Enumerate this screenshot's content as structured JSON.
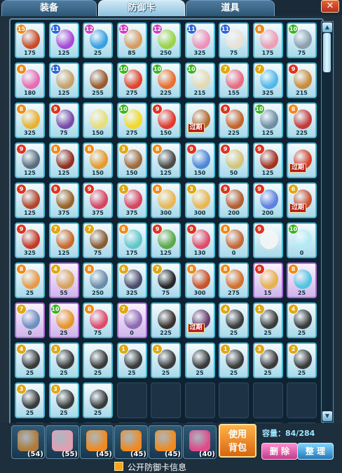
{
  "tabs": [
    {
      "label": "装备"
    },
    {
      "label": "防御卡"
    },
    {
      "label": "道具"
    }
  ],
  "close_label": "✕",
  "colors": {
    "blue_card": "#43b8d4",
    "purple_card": "#a76ad6",
    "expired": "#b31a10",
    "use_button": "#d8650d"
  },
  "cards": [
    {
      "level": "15",
      "lvl_color": "o",
      "cost": "175",
      "plant": "#c94b2a",
      "frame": "blue"
    },
    {
      "level": "11",
      "lvl_color": "b",
      "cost": "125",
      "plant": "#a94ad6",
      "frame": "blue"
    },
    {
      "level": "12",
      "lvl_color": "p",
      "cost": "25",
      "plant": "#3a9fe0",
      "frame": "blue"
    },
    {
      "level": "12",
      "lvl_color": "p",
      "cost": "85",
      "plant": "#d59b63",
      "frame": "blue"
    },
    {
      "level": "12",
      "lvl_color": "p",
      "cost": "250",
      "plant": "#9bd24a",
      "frame": "blue"
    },
    {
      "level": "11",
      "lvl_color": "b",
      "cost": "325",
      "plant": "#f08fb8",
      "frame": "blue"
    },
    {
      "level": "11",
      "lvl_color": "b",
      "cost": "75",
      "plant": "#e9e1d4",
      "frame": "blue"
    },
    {
      "level": "8",
      "lvl_color": "o",
      "cost": "175",
      "plant": "#ee9db4",
      "frame": "blue"
    },
    {
      "level": "10",
      "lvl_color": "g",
      "cost": "75",
      "plant": "#8aa0b0",
      "frame": "blue"
    },
    {
      "level": "8",
      "lvl_color": "o",
      "cost": "180",
      "plant": "#e86ab3",
      "frame": "blue"
    },
    {
      "level": "11",
      "lvl_color": "b",
      "cost": "125",
      "plant": "#c7a06b",
      "frame": "blue"
    },
    {
      "level": "",
      "lvl_color": "o",
      "cost": "255",
      "plant": "#9a5a2c",
      "frame": "blue"
    },
    {
      "level": "10",
      "lvl_color": "g",
      "cost": "275",
      "plant": "#e0452b",
      "frame": "blue"
    },
    {
      "level": "10",
      "lvl_color": "g",
      "cost": "225",
      "plant": "#e96e2e",
      "frame": "blue"
    },
    {
      "level": "10",
      "lvl_color": "g",
      "cost": "215",
      "plant": "#e4d9b2",
      "frame": "blue"
    },
    {
      "level": "7",
      "lvl_color": "y",
      "cost": "155",
      "plant": "#ea6a80",
      "frame": "blue"
    },
    {
      "level": "7",
      "lvl_color": "y",
      "cost": "325",
      "plant": "#51b6ea",
      "frame": "blue"
    },
    {
      "level": "9",
      "lvl_color": "r",
      "cost": "215",
      "plant": "#c98a3a",
      "frame": "blue"
    },
    {
      "level": "8",
      "lvl_color": "o",
      "cost": "325",
      "plant": "#e8b12f",
      "frame": "blue"
    },
    {
      "level": "9",
      "lvl_color": "r",
      "cost": "75",
      "plant": "#7a4aa8",
      "frame": "blue"
    },
    {
      "level": "",
      "lvl_color": "o",
      "cost": "150",
      "plant": "#e9dd7a",
      "frame": "blue"
    },
    {
      "level": "10",
      "lvl_color": "g",
      "cost": "275",
      "plant": "#f2d82a",
      "frame": "blue"
    },
    {
      "level": "9",
      "lvl_color": "r",
      "cost": "150",
      "plant": "#e03a2e",
      "frame": "blue"
    },
    {
      "level": "",
      "lvl_color": "o",
      "cost": "",
      "plant": "#b66a30",
      "frame": "blue",
      "expired": "过期"
    },
    {
      "level": "9",
      "lvl_color": "r",
      "cost": "225",
      "plant": "#c2652d",
      "frame": "blue"
    },
    {
      "level": "10",
      "lvl_color": "g",
      "cost": "125",
      "plant": "#6f8da2",
      "frame": "blue"
    },
    {
      "level": "8",
      "lvl_color": "o",
      "cost": "225",
      "plant": "#c23a3a",
      "frame": "blue"
    },
    {
      "level": "9",
      "lvl_color": "r",
      "cost": "125",
      "plant": "#5a6c7c",
      "frame": "blue"
    },
    {
      "level": "8",
      "lvl_color": "o",
      "cost": "125",
      "plant": "#923020",
      "frame": "blue"
    },
    {
      "level": "8",
      "lvl_color": "o",
      "cost": "150",
      "plant": "#e7992a",
      "frame": "blue"
    },
    {
      "level": "3",
      "lvl_color": "y",
      "cost": "150",
      "plant": "#9f6a3a",
      "frame": "blue"
    },
    {
      "level": "8",
      "lvl_color": "o",
      "cost": "125",
      "plant": "#4d4a46",
      "frame": "blue"
    },
    {
      "level": "9",
      "lvl_color": "r",
      "cost": "150",
      "plant": "#4f87d8",
      "frame": "blue"
    },
    {
      "level": "9",
      "lvl_color": "r",
      "cost": "50",
      "plant": "#d6c37a",
      "frame": "blue"
    },
    {
      "level": "9",
      "lvl_color": "r",
      "cost": "125",
      "plant": "#a3311e",
      "frame": "blue"
    },
    {
      "level": "",
      "lvl_color": "o",
      "cost": "",
      "plant": "#d4412a",
      "frame": "blue",
      "expired": "过期"
    },
    {
      "level": "9",
      "lvl_color": "r",
      "cost": "125",
      "plant": "#b3452a",
      "frame": "blue"
    },
    {
      "level": "9",
      "lvl_color": "r",
      "cost": "375",
      "plant": "#9a6226",
      "frame": "blue"
    },
    {
      "level": "9",
      "lvl_color": "r",
      "cost": "375",
      "plant": "#d8435f",
      "frame": "blue"
    },
    {
      "level": "1",
      "lvl_color": "y",
      "cost": "375",
      "plant": "#d8435f",
      "frame": "blue"
    },
    {
      "level": "8",
      "lvl_color": "o",
      "cost": "300",
      "plant": "#eab654",
      "frame": "blue"
    },
    {
      "level": "3",
      "lvl_color": "y",
      "cost": "300",
      "plant": "#eab654",
      "frame": "blue"
    },
    {
      "level": "9",
      "lvl_color": "r",
      "cost": "200",
      "plant": "#b35d30",
      "frame": "blue"
    },
    {
      "level": "9",
      "lvl_color": "r",
      "cost": "200",
      "plant": "#5e7fe0",
      "frame": "blue"
    },
    {
      "level": "6",
      "lvl_color": "y",
      "cost": "",
      "plant": "#c65030",
      "frame": "blue",
      "expired": "过期"
    },
    {
      "level": "9",
      "lvl_color": "r",
      "cost": "325",
      "plant": "#c43a26",
      "frame": "blue"
    },
    {
      "level": "7",
      "lvl_color": "y",
      "cost": "125",
      "plant": "#c86a2c",
      "frame": "blue"
    },
    {
      "level": "7",
      "lvl_color": "y",
      "cost": "75",
      "plant": "#8a5a32",
      "frame": "blue"
    },
    {
      "level": "8",
      "lvl_color": "o",
      "cost": "175",
      "plant": "#62c6c9",
      "frame": "blue"
    },
    {
      "level": "9",
      "lvl_color": "r",
      "cost": "125",
      "plant": "#5da84a",
      "frame": "blue"
    },
    {
      "level": "9",
      "lvl_color": "r",
      "cost": "130",
      "plant": "#e04a6a",
      "frame": "blue"
    },
    {
      "level": "8",
      "lvl_color": "o",
      "cost": "0",
      "plant": "#c4683a",
      "frame": "blue"
    },
    {
      "level": "9",
      "lvl_color": "r",
      "cost": "",
      "plant": "#f4f4f4",
      "frame": "blue"
    },
    {
      "level": "10",
      "lvl_color": "g",
      "cost": "0",
      "plant": "#b2eaf4",
      "frame": "blue"
    },
    {
      "level": "8",
      "lvl_color": "o",
      "cost": "25",
      "plant": "#e69a4a",
      "frame": "blue"
    },
    {
      "level": "4",
      "lvl_color": "y",
      "cost": "55",
      "plant": "#d6a35a",
      "frame": "purple"
    },
    {
      "level": "8",
      "lvl_color": "o",
      "cost": "250",
      "plant": "#6b8ca8",
      "frame": "blue"
    },
    {
      "level": "6",
      "lvl_color": "y",
      "cost": "325",
      "plant": "#4c4c6a",
      "frame": "blue"
    },
    {
      "level": "7",
      "lvl_color": "y",
      "cost": "75",
      "plant": "#262626",
      "frame": "blue"
    },
    {
      "level": "8",
      "lvl_color": "o",
      "cost": "300",
      "plant": "#c8522a",
      "frame": "blue"
    },
    {
      "level": "8",
      "lvl_color": "o",
      "cost": "275",
      "plant": "#d2702e",
      "frame": "blue"
    },
    {
      "level": "9",
      "lvl_color": "r",
      "cost": "15",
      "plant": "#e6b24a",
      "frame": "purple"
    },
    {
      "level": "8",
      "lvl_color": "o",
      "cost": "25",
      "plant": "#4fc5e0",
      "frame": "purple"
    },
    {
      "level": "7",
      "lvl_color": "y",
      "cost": "0",
      "plant": "#6d8fc0",
      "frame": "purple"
    },
    {
      "level": "10",
      "lvl_color": "g",
      "cost": "25",
      "plant": "#e6952c",
      "frame": "purple"
    },
    {
      "level": "8",
      "lvl_color": "o",
      "cost": "75",
      "plant": "#e04a6a",
      "frame": "blue"
    },
    {
      "level": "7",
      "lvl_color": "y",
      "cost": "0",
      "plant": "#8c6ab4",
      "frame": "purple"
    },
    {
      "level": "",
      "lvl_color": "o",
      "cost": "225",
      "plant": "#3a2f2c",
      "frame": "blue"
    },
    {
      "level": "",
      "lvl_color": "o",
      "cost": "",
      "plant": "#6a3a6a",
      "frame": "blue",
      "expired": "过期"
    },
    {
      "level": "4",
      "lvl_color": "y",
      "cost": "25",
      "plant": "#3a3a3a",
      "frame": "blue"
    },
    {
      "level": "1",
      "lvl_color": "y",
      "cost": "25",
      "plant": "#3a3a3a",
      "frame": "blue"
    },
    {
      "level": "4",
      "lvl_color": "y",
      "cost": "25",
      "plant": "#3a3a3a",
      "frame": "blue"
    },
    {
      "level": "4",
      "lvl_color": "y",
      "cost": "25",
      "plant": "#3a3a3a",
      "frame": "blue"
    },
    {
      "level": "3",
      "lvl_color": "y",
      "cost": "25",
      "plant": "#3a3a3a",
      "frame": "blue"
    },
    {
      "level": "",
      "lvl_color": "o",
      "cost": "25",
      "plant": "#3a3a3a",
      "frame": "blue"
    },
    {
      "level": "1",
      "lvl_color": "y",
      "cost": "25",
      "plant": "#3a3a3a",
      "frame": "blue"
    },
    {
      "level": "1",
      "lvl_color": "y",
      "cost": "25",
      "plant": "#3a3a3a",
      "frame": "blue"
    },
    {
      "level": "",
      "lvl_color": "o",
      "cost": "25",
      "plant": "#3a3a3a",
      "frame": "blue"
    },
    {
      "level": "1",
      "lvl_color": "y",
      "cost": "25",
      "plant": "#3a3a3a",
      "frame": "blue"
    },
    {
      "level": "3",
      "lvl_color": "y",
      "cost": "25",
      "plant": "#3a3a3a",
      "frame": "blue"
    },
    {
      "level": "2",
      "lvl_color": "y",
      "cost": "25",
      "plant": "#3a3a3a",
      "frame": "blue"
    },
    {
      "level": "3",
      "lvl_color": "y",
      "cost": "25",
      "plant": "#3a3a3a",
      "frame": "blue"
    },
    {
      "level": "3",
      "lvl_color": "y",
      "cost": "25",
      "plant": "#3a3a3a",
      "frame": "blue"
    },
    {
      "level": "",
      "lvl_color": "o",
      "cost": "25",
      "plant": "#3a3a3a",
      "frame": "blue"
    }
  ],
  "bags": [
    {
      "count": "(54)",
      "color": "#b07a3a"
    },
    {
      "count": "(55)",
      "color": "#e1a0b0"
    },
    {
      "count": "(45)",
      "color": "#f08a20"
    },
    {
      "count": "(45)",
      "color": "#f08a20"
    },
    {
      "count": "(45)",
      "color": "#f08a20"
    },
    {
      "count": "(40)",
      "color": "#e04a8a"
    }
  ],
  "use_button": {
    "line1": "使用",
    "line2": "背包"
  },
  "capacity": "容量：84/284",
  "delete_label": "删 除",
  "sort_label": "整 理",
  "public_label": "公开防御卡信息"
}
